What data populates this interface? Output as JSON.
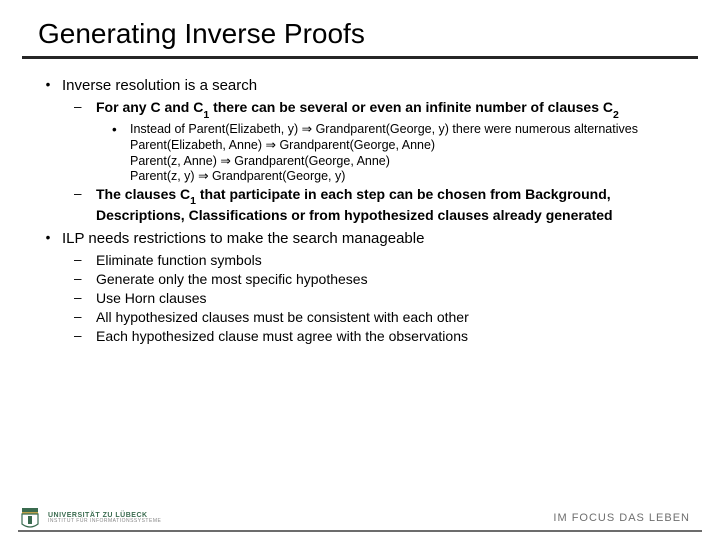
{
  "title": "Generating Inverse Proofs",
  "b1": {
    "text": "Inverse resolution is a search",
    "s1": {
      "pre": "For any C and C",
      "sub": "1",
      "mid": " there can be several or even an infinite number of clauses C",
      "sub2": "2",
      "ex_lead": "Instead of Parent(Elizabeth, y) ⇒ Grandparent(George, y) there were numerous alternatives",
      "ex1": "Parent(Elizabeth, Anne) ⇒ Grandparent(George, Anne)",
      "ex2": "Parent(z, Anne) ⇒ Grandparent(George, Anne)",
      "ex3": "Parent(z, y) ⇒ Grandparent(George, y)"
    },
    "s2": {
      "pre": "The clauses C",
      "sub": "1",
      "post": " that participate in each step can be chosen from Background, Descriptions, Classifications or from hypothesized clauses already generated"
    }
  },
  "b2": {
    "text": "ILP needs restrictions to make the search manageable",
    "r1": "Eliminate function symbols",
    "r2": "Generate only the most specific hypotheses",
    "r3": "Use Horn clauses",
    "r4": "All hypothesized clauses must be consistent with each other",
    "r5": "Each hypothesized clause must agree with the observations"
  },
  "footer": {
    "uni_main": "UNIVERSITÄT ZU LÜBECK",
    "uni_sub": "INSTITUT FÜR INFORMATIONSSYSTEME",
    "focus": "IM FOCUS DAS LEBEN"
  },
  "bullets": {
    "dot": "•",
    "dash": "–"
  }
}
